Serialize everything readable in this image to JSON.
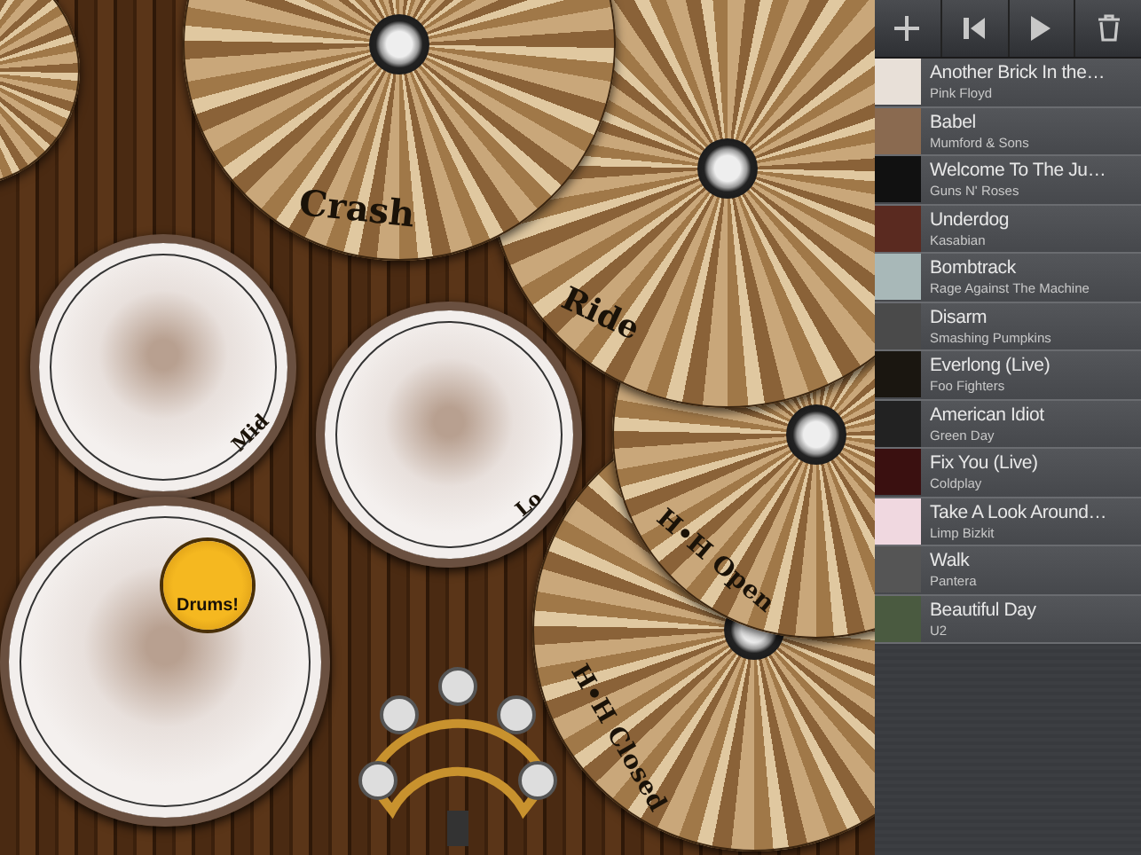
{
  "drum_kit": {
    "logo": "Drums!",
    "pieces": [
      {
        "kind": "cymbal"
      },
      {
        "kind": "cymbal",
        "label": "H•H Closed"
      },
      {
        "kind": "cymbal",
        "label": "H•H Open"
      },
      {
        "kind": "cymbal",
        "label": "Ride"
      },
      {
        "kind": "cymbal",
        "label": "Crash"
      },
      {
        "kind": "drum",
        "label": "Mid"
      },
      {
        "kind": "drum",
        "label": "Lo"
      },
      {
        "kind": "drum"
      },
      {
        "kind": "tambourine"
      }
    ]
  },
  "playlist": {
    "toolbar": [
      {
        "kind": "add"
      },
      {
        "kind": "previous"
      },
      {
        "kind": "play"
      },
      {
        "kind": "delete"
      }
    ],
    "tracks": [
      {
        "title": "Another Brick In the…",
        "artist": "Pink Floyd"
      },
      {
        "title": "Babel",
        "artist": "Mumford & Sons"
      },
      {
        "title": "Welcome To The Ju…",
        "artist": "Guns N' Roses"
      },
      {
        "title": "Underdog",
        "artist": "Kasabian"
      },
      {
        "title": "Bombtrack",
        "artist": "Rage Against The Machine"
      },
      {
        "title": "Disarm",
        "artist": "Smashing Pumpkins"
      },
      {
        "title": "Everlong (Live)",
        "artist": "Foo Fighters"
      },
      {
        "title": "American Idiot",
        "artist": "Green Day"
      },
      {
        "title": "Fix You (Live)",
        "artist": "Coldplay"
      },
      {
        "title": "Take A Look Around…",
        "artist": "Limp Bizkit"
      },
      {
        "title": "Walk",
        "artist": "Pantera"
      },
      {
        "title": "Beautiful Day",
        "artist": "U2"
      }
    ]
  }
}
